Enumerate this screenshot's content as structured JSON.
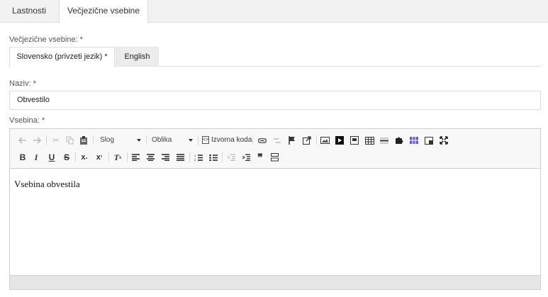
{
  "top_tabs": [
    "Lastnosti",
    "Večjezične vsebine"
  ],
  "multilang_label": "Večjezične vsebine: *",
  "lang_tabs": [
    "Slovensko (privzeti jezik) *",
    "English"
  ],
  "name_field": {
    "label": "Naziv: *",
    "value": "Obvestilo"
  },
  "content_field": {
    "label": "Vsebina: *"
  },
  "toolbar": {
    "style_combo": "Slog",
    "format_combo": "Oblika",
    "source_label": "Izvorna koda"
  },
  "editor_content": "Vsebina obvestila"
}
